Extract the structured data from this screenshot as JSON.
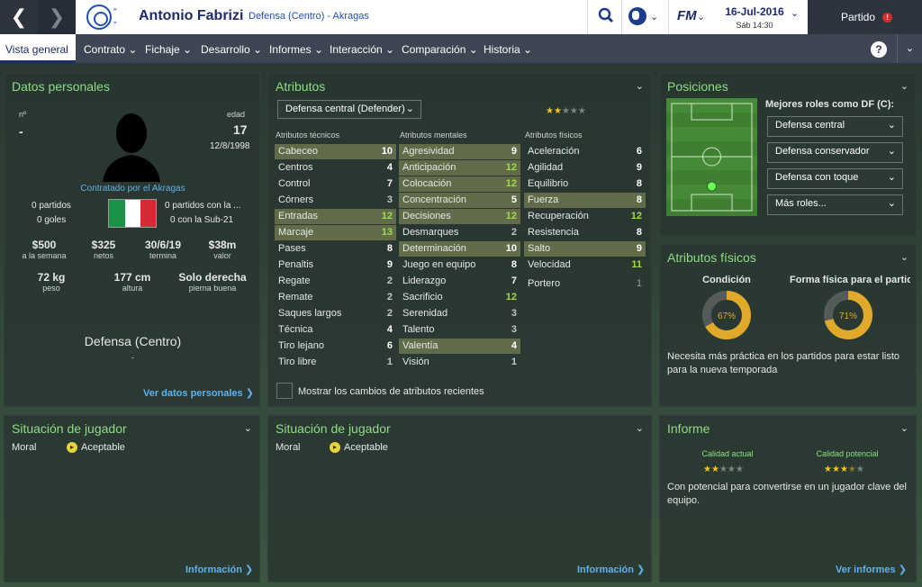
{
  "topbar": {
    "player_name": "Antonio Fabrizi",
    "player_sub": "Defensa (Centro) - Akragas",
    "date": "16-Jul-2016",
    "time": "Sáb 14:30",
    "match_button": "Partido",
    "fm_logo": "FM",
    "match_badge": "!"
  },
  "menu": {
    "items": [
      "Vista general",
      "Contrato",
      "Fichaje",
      "Desarrollo",
      "Informes",
      "Interacción",
      "Comparación",
      "Historia"
    ],
    "help": "?"
  },
  "personal": {
    "title": "Datos personales",
    "num_label": "nº",
    "num_value": "-",
    "age_label": "edad",
    "age_value": "17",
    "dob": "12/8/1998",
    "contract": "Contratado por el Akragas",
    "matches": "0 partidos",
    "goals": "0 goles",
    "matches_u21": "0 partidos con la ...",
    "goals_u21": "0 con la Sub-21",
    "stats": [
      {
        "v": "$500",
        "l": "a la semana"
      },
      {
        "v": "$325",
        "l": "netos"
      },
      {
        "v": "30/6/19",
        "l": "termina"
      },
      {
        "v": "$38m",
        "l": "valor"
      }
    ],
    "phys": [
      {
        "v": "72 kg",
        "l": "peso"
      },
      {
        "v": "177 cm",
        "l": "altura"
      },
      {
        "v": "Solo derecha",
        "l": "pierna buena"
      }
    ],
    "position": "Defensa (Centro)",
    "position_sub": "-",
    "link": "Ver datos personales"
  },
  "attributes": {
    "title": "Atributos",
    "role": "Defensa central (Defender)",
    "role_stars": 2,
    "role_stars_total": 5,
    "headers": [
      "Atributos técnicos",
      "Atributos mentales",
      "Atributos físicos"
    ],
    "technical": [
      [
        "Cabeceo",
        "10"
      ],
      [
        "Centros",
        "4"
      ],
      [
        "Control",
        "7"
      ],
      [
        "Córners",
        "3"
      ],
      [
        "Entradas",
        "12"
      ],
      [
        "Marcaje",
        "13"
      ],
      [
        "Pases",
        "8"
      ],
      [
        "Penaltis",
        "9"
      ],
      [
        "Regate",
        "2"
      ],
      [
        "Remate",
        "2"
      ],
      [
        "Saques largos",
        "2"
      ],
      [
        "Técnica",
        "4"
      ],
      [
        "Tiro lejano",
        "6"
      ],
      [
        "Tiro libre",
        "1"
      ]
    ],
    "mental": [
      [
        "Agresividad",
        "9"
      ],
      [
        "Anticipación",
        "12"
      ],
      [
        "Colocación",
        "12"
      ],
      [
        "Concentración",
        "5"
      ],
      [
        "Decisiones",
        "12"
      ],
      [
        "Desmarques",
        "2"
      ],
      [
        "Determinación",
        "10"
      ],
      [
        "Juego en equipo",
        "8"
      ],
      [
        "Liderazgo",
        "7"
      ],
      [
        "Sacrificio",
        "12"
      ],
      [
        "Serenidad",
        "3"
      ],
      [
        "Talento",
        "3"
      ],
      [
        "Valentía",
        "4"
      ],
      [
        "Visión",
        "1"
      ]
    ],
    "physical": [
      [
        "Aceleración",
        "6"
      ],
      [
        "Agilidad",
        "9"
      ],
      [
        "Equilibrio",
        "8"
      ],
      [
        "Fuerza",
        "8"
      ],
      [
        "Recuperación",
        "12"
      ],
      [
        "Resistencia",
        "8"
      ],
      [
        "Salto",
        "9"
      ],
      [
        "Velocidad",
        "11"
      ]
    ],
    "goalkeeper": [
      [
        "Portero",
        "1"
      ]
    ],
    "checkbox_label": "Mostrar los cambios de atributos recientes"
  },
  "positions": {
    "title": "Posiciones",
    "roles_title": "Mejores roles como DF (C):",
    "roles": [
      "Defensa central",
      "Defensa conservador",
      "Defensa con toque",
      "Más roles..."
    ]
  },
  "fitness": {
    "title": "Atributos físicos",
    "cond_label": "Condición",
    "cond_value": "67%",
    "cond_fraction": 0.67,
    "form_label": "Forma física para el partido",
    "form_value": "71%",
    "form_fraction": 0.71,
    "note": "Necesita más práctica en los partidos para estar listo para la nueva temporada"
  },
  "situation1": {
    "title": "Situación de jugador",
    "moral_label": "Moral",
    "moral_value": "Aceptable",
    "link": "Información"
  },
  "situation2": {
    "title": "Situación de jugador",
    "moral_label": "Moral",
    "moral_value": "Aceptable",
    "link": "Información"
  },
  "report": {
    "title": "Informe",
    "current_label": "Calidad actual",
    "current_stars": 2,
    "potential_label": "Calidad potencial",
    "potential_stars": 3.5,
    "text": "Con potencial para convertirse en un jugador clave del equipo.",
    "link": "Ver informes"
  },
  "colors": {
    "accent": "#8fdc84",
    "link": "#5fb2ef",
    "gold": "#e0a92a",
    "navy": "#1c2a6e"
  }
}
